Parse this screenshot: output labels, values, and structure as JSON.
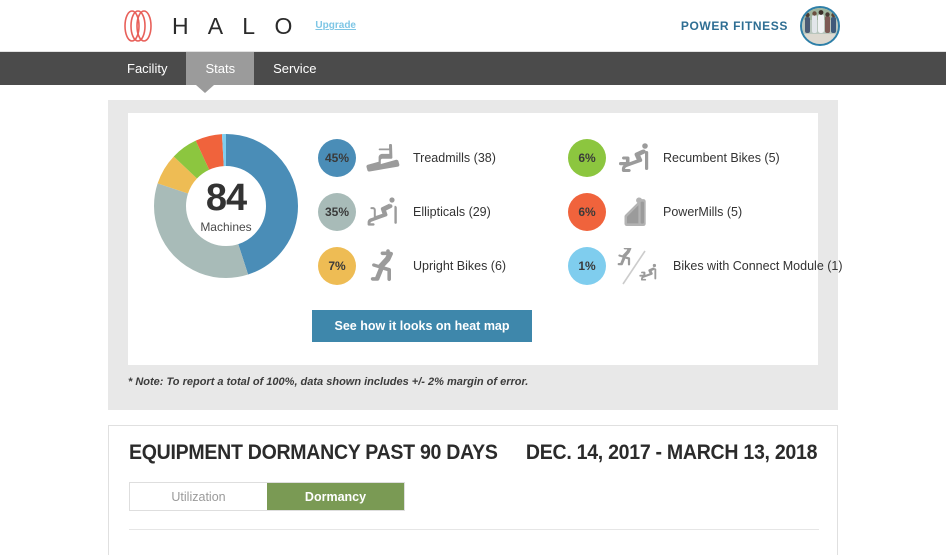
{
  "header": {
    "logo_word": "H A L O",
    "logo_icon": "halo-rings-logo",
    "upgrade_label": "Upgrade",
    "brand_name": "POWER FITNESS",
    "avatar_icon": "runners-photo-avatar"
  },
  "nav": {
    "items": [
      {
        "label": "Facility",
        "active": false
      },
      {
        "label": "Stats",
        "active": true
      },
      {
        "label": "Service",
        "active": false
      }
    ]
  },
  "stats_panel": {
    "donut": {
      "total": "84",
      "total_label": "Machines"
    },
    "legend_left": [
      {
        "percent": "45%",
        "label": "Treadmills (38)",
        "color": "#4a8db7",
        "icon": "treadmill-icon"
      },
      {
        "percent": "35%",
        "label": "Ellipticals (29)",
        "color": "#a8bbb8",
        "icon": "elliptical-icon"
      },
      {
        "percent": "7%",
        "label": "Upright Bikes (6)",
        "color": "#eebc54",
        "icon": "upright-bike-icon"
      }
    ],
    "legend_right": [
      {
        "percent": "6%",
        "label": "Recumbent Bikes (5)",
        "color": "#8cc63f",
        "icon": "recumbent-bike-icon"
      },
      {
        "percent": "6%",
        "label": "PowerMills (5)",
        "color": "#f0633c",
        "icon": "powermill-icon"
      },
      {
        "percent": "1%",
        "label": "Bikes with Connect Module (1)",
        "color": "#7fcdee",
        "icon": "connect-module-bikes-icon"
      }
    ],
    "heatmap_button": "See how it looks on heat map",
    "note": "* Note: To report a total of 100%, data shown includes +/- 2% margin of error."
  },
  "dormancy_panel": {
    "title": "EQUIPMENT DORMANCY PAST 90 DAYS",
    "date_range": "DEC. 14, 2017 - MARCH 13, 2018",
    "toggle": {
      "options": [
        {
          "label": "Utilization",
          "active": false
        },
        {
          "label": "Dormancy",
          "active": true
        }
      ]
    }
  },
  "colors": {
    "nav_bg": "#4b4b4b",
    "nav_active": "#9b9b9b",
    "brand_blue": "#2e6e93",
    "button_blue": "#3e87ab",
    "toggle_green": "#7a9a54",
    "panel_gray": "#e8e8e8",
    "logo_red": "#e8605a"
  },
  "chart_data": {
    "type": "pie",
    "title": "Machines by equipment type",
    "categories": [
      "Treadmills",
      "Ellipticals",
      "Upright Bikes",
      "Recumbent Bikes",
      "PowerMills",
      "Bikes with Connect Module"
    ],
    "values": [
      45,
      35,
      7,
      6,
      6,
      1
    ],
    "counts": [
      38,
      29,
      6,
      5,
      5,
      1
    ],
    "total": 84,
    "total_label": "Machines",
    "unit": "%",
    "colors": [
      "#4a8db7",
      "#a8bbb8",
      "#eebc54",
      "#8cc63f",
      "#f0633c",
      "#7fcdee"
    ],
    "legend_position": "right",
    "donut": true,
    "start_angle": 0,
    "direction": "clockwise"
  }
}
